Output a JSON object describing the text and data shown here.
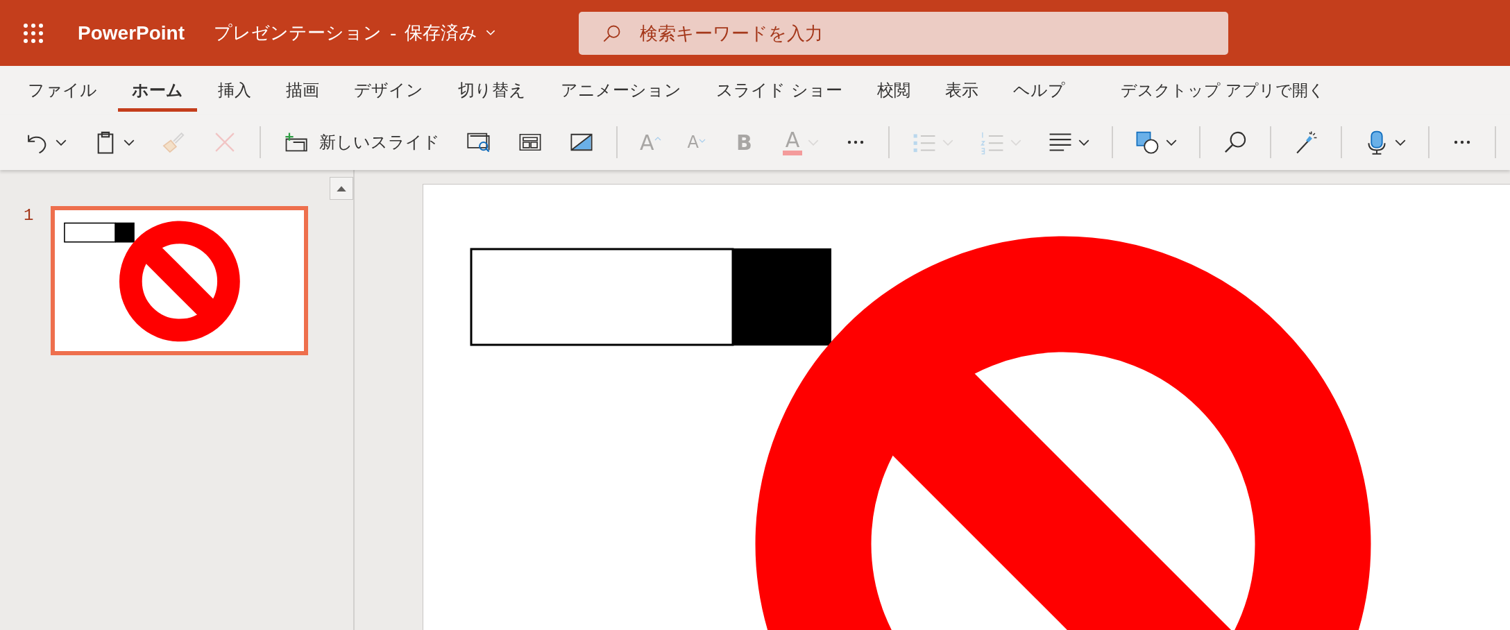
{
  "header": {
    "app_name": "PowerPoint",
    "document_title": "プレゼンテーション",
    "separator": "-",
    "save_status": "保存済み",
    "search": {
      "placeholder": "検索キーワードを入力"
    }
  },
  "tabs": [
    {
      "label": "ファイル",
      "selected": false
    },
    {
      "label": "ホーム",
      "selected": true
    },
    {
      "label": "挿入",
      "selected": false
    },
    {
      "label": "描画",
      "selected": false
    },
    {
      "label": "デザイン",
      "selected": false
    },
    {
      "label": "切り替え",
      "selected": false
    },
    {
      "label": "アニメーション",
      "selected": false
    },
    {
      "label": "スライド ショー",
      "selected": false
    },
    {
      "label": "校閲",
      "selected": false
    },
    {
      "label": "表示",
      "selected": false
    },
    {
      "label": "ヘルプ",
      "selected": false
    }
  ],
  "open_in_desktop": "デスクトップ アプリで開く",
  "toolbar": {
    "groups": [
      [
        {
          "kind": "undo",
          "disabled": false,
          "menu": true
        },
        {
          "kind": "clipboard",
          "disabled": false,
          "menu": true
        },
        {
          "kind": "painter",
          "disabled": true,
          "menu": false
        },
        {
          "kind": "delete",
          "disabled": true,
          "menu": false
        }
      ],
      [
        {
          "kind": "new_slide",
          "label": "新しいスライド",
          "disabled": false,
          "menu": false
        },
        {
          "kind": "reuse",
          "disabled": false,
          "menu": false
        },
        {
          "kind": "layout",
          "disabled": false,
          "menu": false
        },
        {
          "kind": "background",
          "disabled": false,
          "menu": false
        }
      ],
      [
        {
          "kind": "grow",
          "label": "A",
          "disabled": true,
          "menu": false
        },
        {
          "kind": "shrink",
          "label": "A",
          "disabled": true,
          "menu": false
        },
        {
          "kind": "bold",
          "label": "B",
          "disabled": true,
          "menu": false
        },
        {
          "kind": "font_color",
          "label": "A",
          "disabled": true,
          "menu": true
        },
        {
          "kind": "more",
          "disabled": false,
          "menu": false
        }
      ],
      [
        {
          "kind": "bullets",
          "disabled": true,
          "menu": true
        },
        {
          "kind": "numbering",
          "disabled": true,
          "menu": true
        },
        {
          "kind": "align",
          "disabled": false,
          "menu": true
        }
      ],
      [
        {
          "kind": "shapes",
          "disabled": false,
          "menu": true
        }
      ],
      [
        {
          "kind": "find",
          "disabled": false,
          "menu": false
        }
      ],
      [
        {
          "kind": "designer",
          "disabled": false,
          "menu": false
        }
      ],
      [
        {
          "kind": "dictate",
          "disabled": false,
          "menu": true
        }
      ],
      [
        {
          "kind": "more",
          "disabled": false,
          "menu": false
        }
      ]
    ]
  },
  "slides": [
    {
      "number": "1",
      "selected": true
    }
  ]
}
